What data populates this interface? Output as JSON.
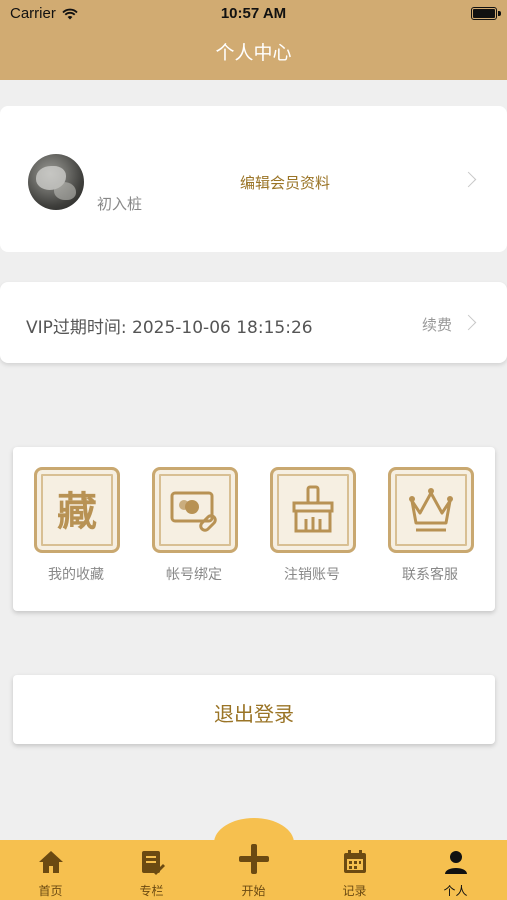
{
  "status_bar": {
    "carrier": "Carrier",
    "time": "10:57 AM"
  },
  "header": {
    "title": "个人中心",
    "background_color": "#d1ab72"
  },
  "profile": {
    "username": "初入桩",
    "edit_label": "编辑会员资料",
    "avatar_icon": "avatar-photo"
  },
  "vip": {
    "expiry_text": "VIP过期时间: 2025-10-06 18:15:26",
    "renew_label": "续费"
  },
  "features": [
    {
      "label": "我的收藏",
      "icon": "collection-icon"
    },
    {
      "label": "帐号绑定",
      "icon": "account-link-icon"
    },
    {
      "label": "注销账号",
      "icon": "broom-icon"
    },
    {
      "label": "联系客服",
      "icon": "crown-icon"
    }
  ],
  "logout": {
    "label": "退出登录"
  },
  "tabbar": {
    "background_color": "#f6c04f",
    "items": [
      {
        "label": "首页",
        "icon": "home-icon"
      },
      {
        "label": "专栏",
        "icon": "column-icon"
      },
      {
        "label": "开始",
        "icon": "plus-icon"
      },
      {
        "label": "记录",
        "icon": "calendar-icon"
      },
      {
        "label": "个人",
        "icon": "person-icon",
        "active": true
      }
    ]
  },
  "colors": {
    "accent_gold": "#9a7426",
    "icon_gold": "#c9a870"
  }
}
